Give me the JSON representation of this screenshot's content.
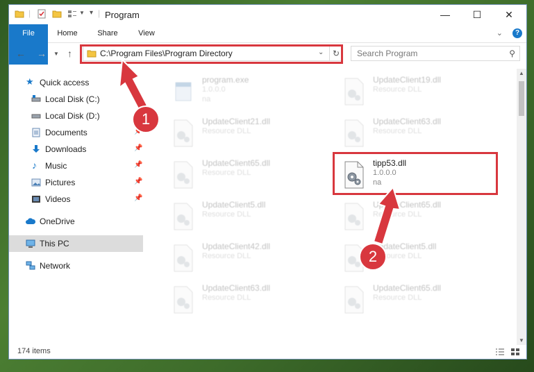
{
  "window": {
    "title": "Program"
  },
  "controls": {
    "minimize": "—",
    "maximize": "☐",
    "close": "✕"
  },
  "ribbon": {
    "tabs": [
      "File",
      "Home",
      "Share",
      "View"
    ]
  },
  "address": {
    "path": "C:\\Program Files\\Program Directory"
  },
  "search": {
    "placeholder": "Search Program"
  },
  "nav": {
    "items": [
      {
        "label": "Quick access",
        "icon": "star-icon",
        "pinned": false
      },
      {
        "label": "Local Disk (C:)",
        "icon": "disk-icon",
        "pinned": true
      },
      {
        "label": "Local Disk (D:)",
        "icon": "disk-icon",
        "pinned": true
      },
      {
        "label": "Documents",
        "icon": "documents-icon",
        "pinned": true
      },
      {
        "label": "Downloads",
        "icon": "download-icon",
        "pinned": true
      },
      {
        "label": "Music",
        "icon": "music-icon",
        "pinned": true
      },
      {
        "label": "Pictures",
        "icon": "pictures-icon",
        "pinned": true
      },
      {
        "label": "Videos",
        "icon": "videos-icon",
        "pinned": true
      },
      {
        "label": "OneDrive",
        "icon": "cloud-icon",
        "pinned": false
      },
      {
        "label": "This PC",
        "icon": "computer-icon",
        "pinned": false
      },
      {
        "label": "Network",
        "icon": "network-icon",
        "pinned": false
      }
    ]
  },
  "files": [
    {
      "name": "program.exe",
      "line2": "1.0.0.0",
      "line3": "na",
      "faded": true,
      "icon": "exe-icon"
    },
    {
      "name": "UpdateClient19.dll",
      "line2": "Resource DLL",
      "line3": "",
      "faded": true,
      "icon": "dll-icon"
    },
    {
      "name": "UpdateClient21.dll",
      "line2": "Resource DLL",
      "line3": "",
      "faded": true,
      "icon": "dll-icon"
    },
    {
      "name": "UpdateClient63.dll",
      "line2": "Resource DLL",
      "line3": "",
      "faded": true,
      "icon": "dll-icon"
    },
    {
      "name": "UpdateClient65.dll",
      "line2": "Resource DLL",
      "line3": "",
      "faded": true,
      "icon": "dll-icon"
    },
    {
      "name": "tipp53.dll",
      "line2": "1.0.0.0",
      "line3": "na",
      "faded": false,
      "icon": "dll-icon"
    },
    {
      "name": "UpdateClient5.dll",
      "line2": "Resource DLL",
      "line3": "",
      "faded": true,
      "icon": "dll-icon"
    },
    {
      "name": "UpdateClient65.dll",
      "line2": "Resource DLL",
      "line3": "",
      "faded": true,
      "icon": "dll-icon"
    },
    {
      "name": "UpdateClient42.dll",
      "line2": "Resource DLL",
      "line3": "",
      "faded": true,
      "icon": "dll-icon"
    },
    {
      "name": "UpdateClient5.dll",
      "line2": "Resource DLL",
      "line3": "",
      "faded": true,
      "icon": "dll-icon"
    },
    {
      "name": "UpdateClient63.dll",
      "line2": "Resource DLL",
      "line3": "",
      "faded": true,
      "icon": "dll-icon"
    },
    {
      "name": "UpdateClient65.dll",
      "line2": "Resource DLL",
      "line3": "",
      "faded": true,
      "icon": "dll-icon"
    }
  ],
  "status": {
    "count": "174 items"
  },
  "annotations": {
    "step1": "1",
    "step2": "2"
  },
  "colors": {
    "accent": "#1979ca",
    "highlight": "#d8373e",
    "selected": "#dcdcdc"
  }
}
